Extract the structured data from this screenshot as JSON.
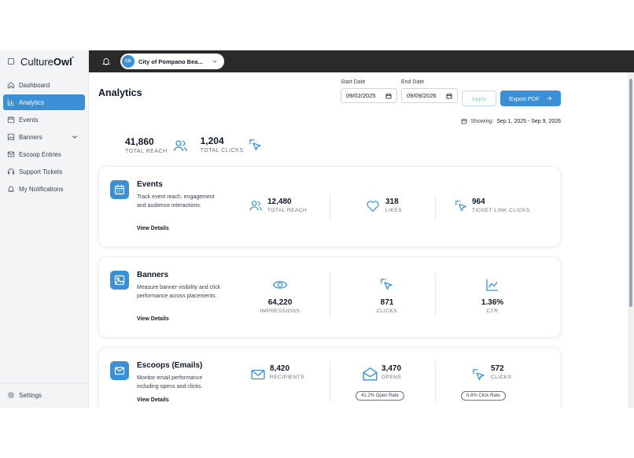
{
  "brand": {
    "name_light": "Culture",
    "name_bold": "Owl"
  },
  "sidebar": {
    "items": [
      {
        "label": "Dashboard",
        "icon": "home-icon"
      },
      {
        "label": "Analytics",
        "icon": "bar-chart-icon",
        "active": true
      },
      {
        "label": "Events",
        "icon": "calendar-icon"
      },
      {
        "label": "Banners",
        "icon": "image-icon",
        "has_chevron": true
      },
      {
        "label": "Escoop Entries",
        "icon": "mail-icon"
      },
      {
        "label": "Support Tickets",
        "icon": "headset-icon"
      },
      {
        "label": "My Notifications",
        "icon": "bell-icon"
      }
    ],
    "settings_label": "Settings"
  },
  "topbar": {
    "org_initials": "CO",
    "org_name": "City of Pompano Bea..."
  },
  "page": {
    "title": "Analytics",
    "start_date_label": "Start Date",
    "start_date_value": "09/02/2025",
    "end_date_label": "End Date",
    "end_date_value": "09/09/2026",
    "apply_label": "Apply",
    "export_label": "Export PDF",
    "showing_prefix": "Showing:",
    "showing_range": "Sep 1, 2025 - Sep 9, 2026"
  },
  "summary": {
    "reach_value": "41,860",
    "reach_label": "TOTAL REACH",
    "clicks_value": "1,204",
    "clicks_label": "TOTAL CLICKS"
  },
  "cards": {
    "events": {
      "title": "Events",
      "desc": "Track event reach, engagement and audience interactions.",
      "link": "View Details",
      "m1_value": "12,480",
      "m1_label": "TOTAL REACH",
      "m2_value": "318",
      "m2_label": "LIKES",
      "m3_value": "964",
      "m3_label": "TICKET LINK CLICKS"
    },
    "banners": {
      "title": "Banners",
      "desc": "Measure banner visibility and click performance across placements.",
      "link": "View Details",
      "m1_value": "64,220",
      "m1_label": "IMPRESSIONS",
      "m2_value": "871",
      "m2_label": "CLICKS",
      "m3_value": "1.36%",
      "m3_label": "CTR"
    },
    "escoops": {
      "title": "Escoops (Emails)",
      "desc": "Monitor email performance including opens and clicks.",
      "link": "View Details",
      "m1_value": "8,420",
      "m1_label": "RECIPIENTS",
      "m2_value": "3,470",
      "m2_label": "OPENS",
      "m2_badge": "41.2% Open Rate",
      "m3_value": "572",
      "m3_label": "CLICKS",
      "m3_badge": "6.8% Click Rate"
    }
  },
  "colors": {
    "accent": "#3b8fd4",
    "topbar": "#2a2a2a",
    "sidebar_bg": "#f3f4f6"
  }
}
